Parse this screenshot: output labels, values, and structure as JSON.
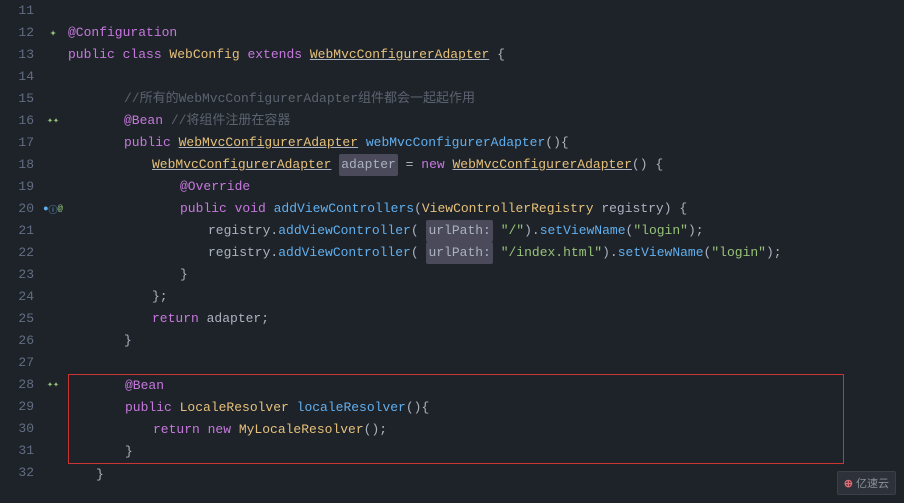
{
  "editor": {
    "background": "#1e2329",
    "lines": [
      {
        "num": "11",
        "gutter": "",
        "indent": "",
        "tokens": []
      },
      {
        "num": "12",
        "gutter": "bean",
        "indent": "",
        "content": "@Configuration",
        "type": "annotation_line"
      },
      {
        "num": "13",
        "gutter": "",
        "indent": "",
        "content": "public class WebConfig extends WebMvcConfigurerAdapter {",
        "type": "class_def"
      },
      {
        "num": "14",
        "gutter": "",
        "indent": "",
        "content": "",
        "type": "empty"
      },
      {
        "num": "15",
        "gutter": "",
        "indent": "        ",
        "content": "//所有的WebMvcConfigurerAdapter组件都会一起起作用",
        "type": "comment_cn"
      },
      {
        "num": "16",
        "gutter": "bean_leaf",
        "indent": "        ",
        "content": "@Bean //将组件注册在容器",
        "type": "annotation_comment"
      },
      {
        "num": "17",
        "gutter": "",
        "indent": "        ",
        "content": "public WebMvcConfigurerAdapter webMvcConfigurerAdapter(){",
        "type": "method_def"
      },
      {
        "num": "18",
        "gutter": "",
        "indent": "            ",
        "content": "WebMvcConfigurerAdapter adapter = new WebMvcConfigurerAdapter() {",
        "type": "var_decl"
      },
      {
        "num": "19",
        "gutter": "",
        "indent": "                ",
        "content": "@Override",
        "type": "annotation_line"
      },
      {
        "num": "20",
        "gutter": "bean_plus_at",
        "indent": "                ",
        "content": "public void addViewControllers(ViewControllerRegistry registry) {",
        "type": "method_override"
      },
      {
        "num": "21",
        "gutter": "",
        "indent": "                    ",
        "content": "registry.addViewController( urlPath: \"/\").setViewName(\"login\");",
        "type": "method_call"
      },
      {
        "num": "22",
        "gutter": "",
        "indent": "                    ",
        "content": "registry.addViewController( urlPath: \"/index.html\").setViewName(\"login\");",
        "type": "method_call2"
      },
      {
        "num": "23",
        "gutter": "",
        "indent": "                ",
        "content": "}",
        "type": "brace"
      },
      {
        "num": "24",
        "gutter": "",
        "indent": "            ",
        "content": "};",
        "type": "brace_semi"
      },
      {
        "num": "25",
        "gutter": "",
        "indent": "            ",
        "content": "return adapter;",
        "type": "return"
      },
      {
        "num": "26",
        "gutter": "",
        "indent": "        ",
        "content": "}",
        "type": "brace"
      },
      {
        "num": "27",
        "gutter": "",
        "indent": "",
        "content": "",
        "type": "empty"
      },
      {
        "num": "28",
        "gutter": "bean_leaf",
        "indent": "        ",
        "content": "@Bean",
        "type": "annotation_line",
        "block_start": true
      },
      {
        "num": "29",
        "gutter": "",
        "indent": "        ",
        "content": "public LocaleResolver localeResolver(){",
        "type": "method_def",
        "in_block": true
      },
      {
        "num": "30",
        "gutter": "",
        "indent": "            ",
        "content": "return new MyLocaleResolver();",
        "type": "return",
        "in_block": true
      },
      {
        "num": "31",
        "gutter": "",
        "indent": "        ",
        "content": "}",
        "type": "brace",
        "block_end": true
      },
      {
        "num": "32",
        "gutter": "",
        "indent": "    ",
        "content": "}",
        "type": "brace"
      }
    ],
    "watermark": {
      "text": "亿速云",
      "logo_char": "云"
    }
  }
}
